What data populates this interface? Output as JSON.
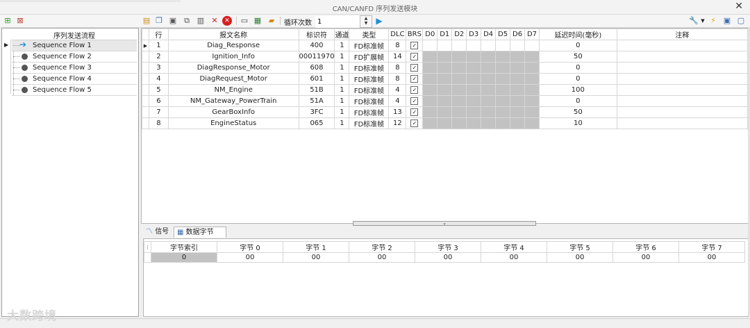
{
  "window": {
    "title": "CAN/CANFD 序列发送模块",
    "close_glyph": "✕"
  },
  "toolbar": {
    "loop_label": "循环次数",
    "loop_value": "1",
    "icons": [
      "add-icon",
      "remove-icon",
      "add-message-icon",
      "copy-icon",
      "paste-icon",
      "duplicate-icon",
      "clipboard-icon",
      "delete-icon",
      "cancel-icon",
      "import-icon",
      "export-icon",
      "folder-icon",
      "run-icon",
      "settings-icon",
      "lightning-icon",
      "window-close-icon",
      "window-icon"
    ]
  },
  "sequence_panel": {
    "header": "序列发送流程",
    "flows": [
      "Sequence Flow 1",
      "Sequence Flow 2",
      "Sequence Flow 3",
      "Sequence Flow 4",
      "Sequence Flow 5"
    ],
    "selected_index": 0
  },
  "message_grid": {
    "columns": [
      "",
      "行",
      "报文名称",
      "标识符",
      "通道",
      "类型",
      "DLC",
      "BRS",
      "D0",
      "D1",
      "D2",
      "D3",
      "D4",
      "D5",
      "D6",
      "D7",
      "延迟时间(毫秒)",
      "注释"
    ],
    "rows": [
      {
        "row": "1",
        "name": "Diag_Response",
        "id": "400",
        "channel": "1",
        "type": "FD标准帧",
        "dlc": "8",
        "brs": true,
        "delay": "0",
        "note": ""
      },
      {
        "row": "2",
        "name": "Ignition_Info",
        "id": "00011970",
        "channel": "1",
        "type": "FD扩展帧",
        "dlc": "14",
        "brs": true,
        "delay": "50",
        "note": ""
      },
      {
        "row": "3",
        "name": "DiagResponse_Motor",
        "id": "608",
        "channel": "1",
        "type": "FD标准帧",
        "dlc": "8",
        "brs": true,
        "delay": "0",
        "note": ""
      },
      {
        "row": "4",
        "name": "DiagRequest_Motor",
        "id": "601",
        "channel": "1",
        "type": "FD标准帧",
        "dlc": "8",
        "brs": true,
        "delay": "0",
        "note": ""
      },
      {
        "row": "5",
        "name": "NM_Engine",
        "id": "51B",
        "channel": "1",
        "type": "FD标准帧",
        "dlc": "4",
        "brs": true,
        "delay": "100",
        "note": ""
      },
      {
        "row": "6",
        "name": "NM_Gateway_PowerTrain",
        "id": "51A",
        "channel": "1",
        "type": "FD标准帧",
        "dlc": "4",
        "brs": true,
        "delay": "0",
        "note": ""
      },
      {
        "row": "7",
        "name": "GearBoxInfo",
        "id": "3FC",
        "channel": "1",
        "type": "FD标准帧",
        "dlc": "13",
        "brs": true,
        "delay": "50",
        "note": ""
      },
      {
        "row": "8",
        "name": "EngineStatus",
        "id": "065",
        "channel": "1",
        "type": "FD标准帧",
        "dlc": "12",
        "brs": true,
        "delay": "10",
        "note": ""
      }
    ]
  },
  "tabs": [
    {
      "label": "信号",
      "icon": "signal-icon",
      "active": false
    },
    {
      "label": "数据字节",
      "icon": "bytes-icon",
      "active": true
    }
  ],
  "bytes_grid": {
    "columns": [
      "字节索引",
      "字节 0",
      "字节 1",
      "字节 2",
      "字节 3",
      "字节 4",
      "字节 5",
      "字节 6",
      "字节 7"
    ],
    "rows": [
      {
        "values": [
          "0",
          "00",
          "00",
          "00",
          "00",
          "00",
          "00",
          "00",
          "00"
        ]
      }
    ]
  },
  "watermark": "大数跨境"
}
